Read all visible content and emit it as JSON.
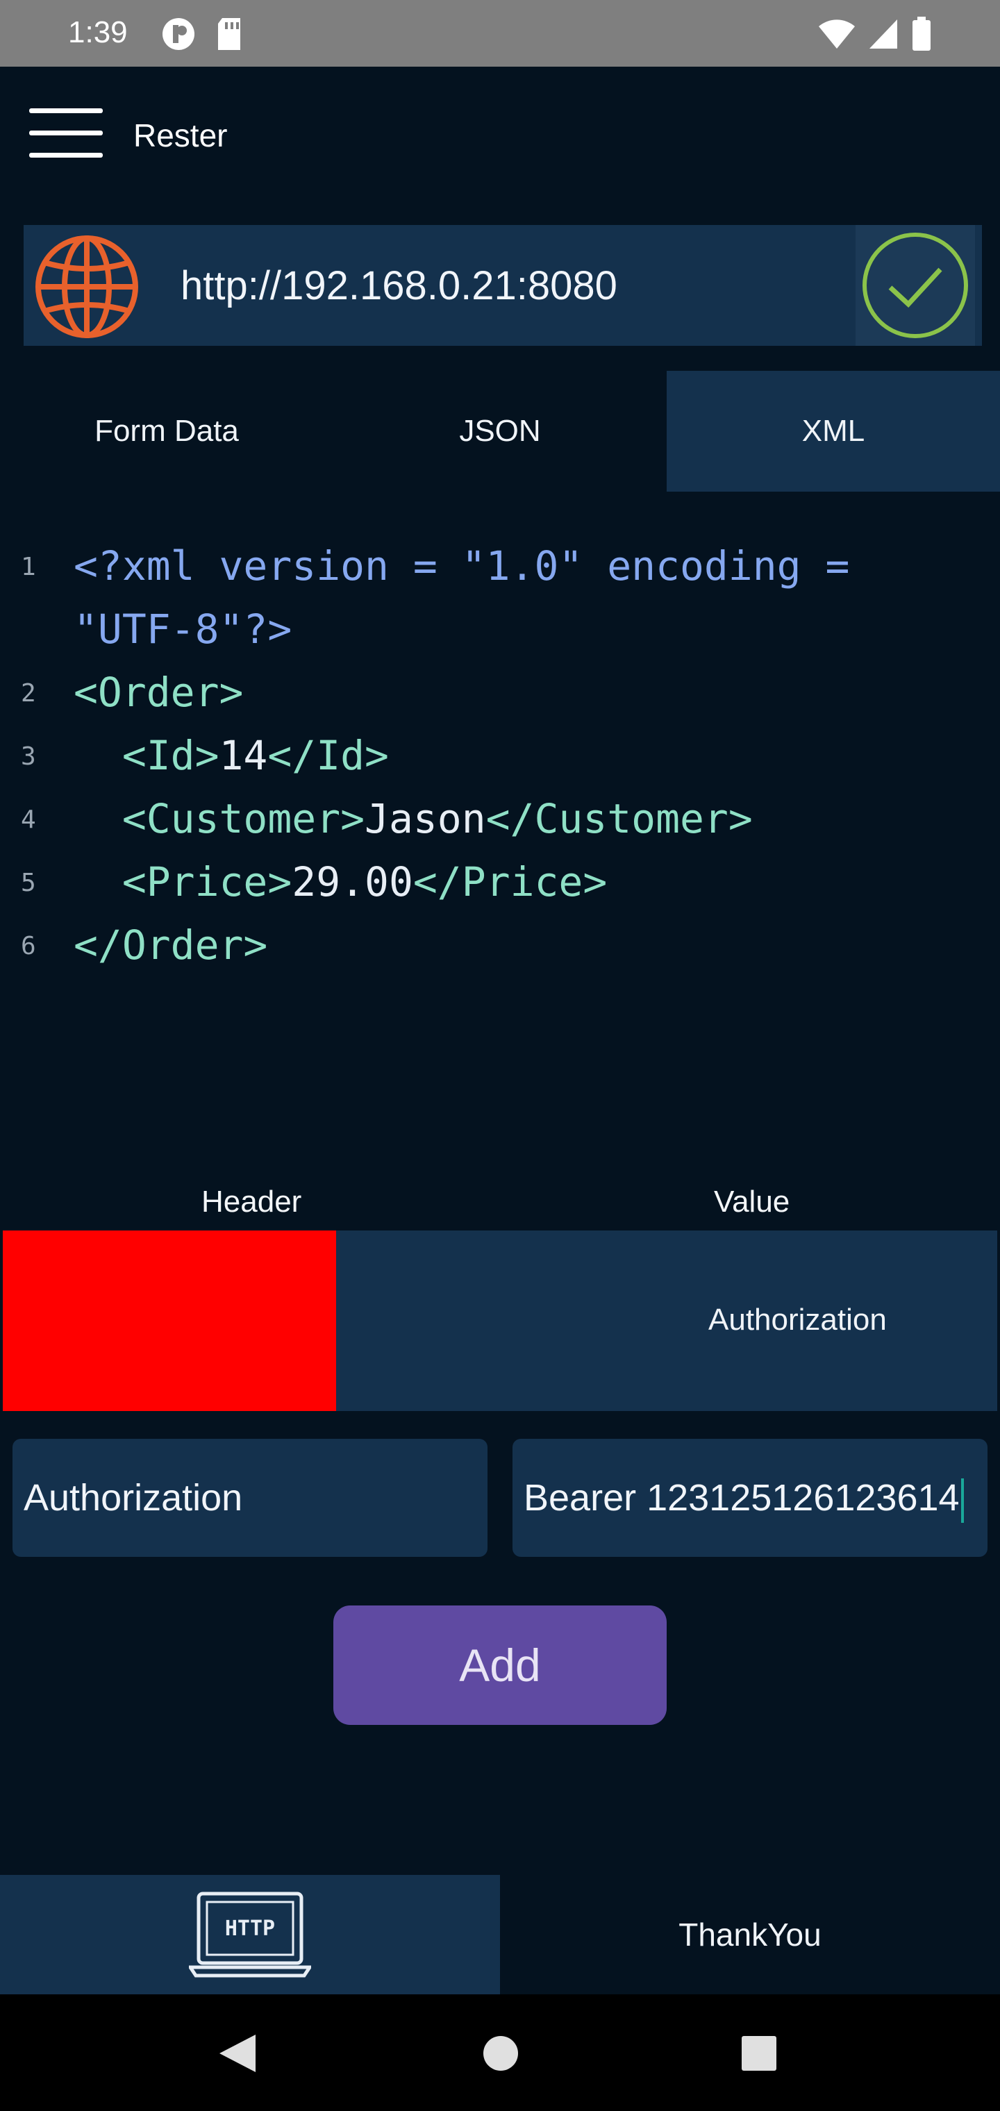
{
  "status_bar": {
    "time": "1:39"
  },
  "app": {
    "title": "Rester"
  },
  "url_bar": {
    "url": "http://192.168.0.21:8080"
  },
  "tabs": [
    {
      "label": "Form Data"
    },
    {
      "label": "JSON"
    },
    {
      "label": "XML"
    }
  ],
  "code": {
    "lines": [
      {
        "n": "1",
        "parts": [
          {
            "t": "<?xml version = \"1.0\" encoding =",
            "k": "decl"
          }
        ]
      },
      {
        "n": "",
        "parts": [
          {
            "t": "\"UTF-8\"?>",
            "k": "decl"
          }
        ]
      },
      {
        "n": "2",
        "parts": [
          {
            "t": "<Order>",
            "k": "tag"
          }
        ]
      },
      {
        "n": "3",
        "parts": [
          {
            "t": "  <Id>",
            "k": "tag"
          },
          {
            "t": "14",
            "k": "text"
          },
          {
            "t": "</Id>",
            "k": "tag"
          }
        ]
      },
      {
        "n": "4",
        "parts": [
          {
            "t": "  <Customer>",
            "k": "tag"
          },
          {
            "t": "Jason",
            "k": "text"
          },
          {
            "t": "</Customer>",
            "k": "tag"
          }
        ]
      },
      {
        "n": "5",
        "parts": [
          {
            "t": "  <Price>",
            "k": "tag"
          },
          {
            "t": "29.00",
            "k": "text"
          },
          {
            "t": "</Price>",
            "k": "tag"
          }
        ]
      },
      {
        "n": "6",
        "parts": [
          {
            "t": "</Order>",
            "k": "tag"
          }
        ]
      }
    ]
  },
  "headers_table": {
    "header_col": "Header",
    "value_col": "Value",
    "row_value": "Authorization"
  },
  "inputs": {
    "header_value": "Authorization",
    "value_value": "Bearer 123125126123614"
  },
  "add_button": {
    "label": "Add"
  },
  "bottom_nav": {
    "http_icon_text": "HTTP",
    "thankyou_label": "ThankYou"
  },
  "colors": {
    "background": "#04121f",
    "panel": "#14314d",
    "accent_purple": "#5f4aa2",
    "globe_orange": "#e8612c",
    "check_green": "#8bc34a",
    "highlight_red": "#ff0000"
  }
}
